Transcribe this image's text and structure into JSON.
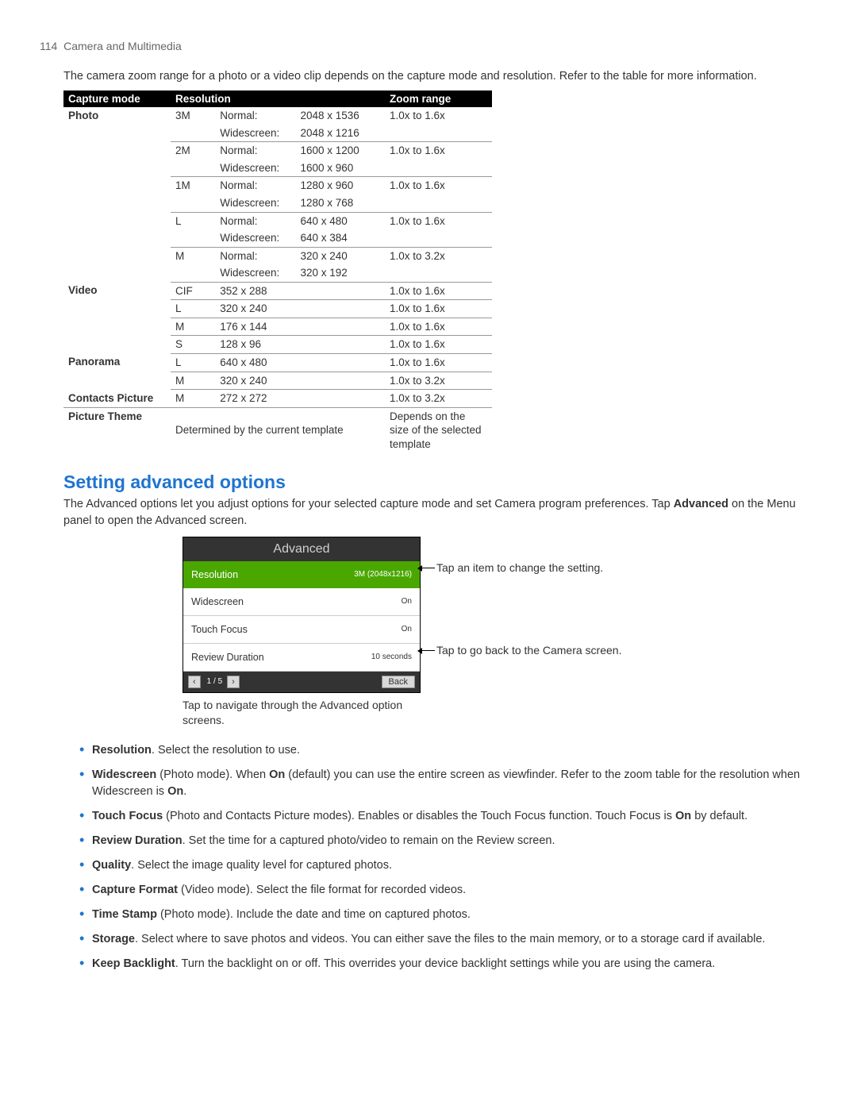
{
  "header": {
    "page_number": "114",
    "title": "Camera and Multimedia"
  },
  "intro": "The camera zoom range for a photo or a video clip depends on the capture mode and resolution. Refer to the table for more information.",
  "table": {
    "headers": {
      "mode": "Capture mode",
      "resolution": "Resolution",
      "zoom": "Zoom range"
    },
    "photo": {
      "label": "Photo",
      "rows": [
        {
          "res": "3M",
          "normal_lbl": "Normal:",
          "normal_val": "2048 x 1536",
          "wide_lbl": "Widescreen:",
          "wide_val": "2048 x 1216",
          "zoom": "1.0x to 1.6x"
        },
        {
          "res": "2M",
          "normal_lbl": "Normal:",
          "normal_val": "1600 x 1200",
          "wide_lbl": "Widescreen:",
          "wide_val": "1600 x 960",
          "zoom": "1.0x to 1.6x"
        },
        {
          "res": "1M",
          "normal_lbl": "Normal:",
          "normal_val": "1280 x 960",
          "wide_lbl": "Widescreen:",
          "wide_val": "1280 x 768",
          "zoom": "1.0x to 1.6x"
        },
        {
          "res": "L",
          "normal_lbl": "Normal:",
          "normal_val": "640 x 480",
          "wide_lbl": "Widescreen:",
          "wide_val": "640 x 384",
          "zoom": "1.0x to 1.6x"
        },
        {
          "res": "M",
          "normal_lbl": "Normal:",
          "normal_val": "320 x 240",
          "wide_lbl": "Widescreen:",
          "wide_val": "320 x 192",
          "zoom": "1.0x to 3.2x"
        }
      ]
    },
    "video": {
      "label": "Video",
      "rows": [
        {
          "res": "CIF",
          "val": "352 x 288",
          "zoom": "1.0x to 1.6x"
        },
        {
          "res": "L",
          "val": "320 x 240",
          "zoom": "1.0x to 1.6x"
        },
        {
          "res": "M",
          "val": "176 x 144",
          "zoom": "1.0x to 1.6x"
        },
        {
          "res": "S",
          "val": "128 x 96",
          "zoom": "1.0x to 1.6x"
        }
      ]
    },
    "panorama": {
      "label": "Panorama",
      "rows": [
        {
          "res": "L",
          "val": "640 x 480",
          "zoom": "1.0x to 1.6x"
        },
        {
          "res": "M",
          "val": "320 x 240",
          "zoom": "1.0x to 3.2x"
        }
      ]
    },
    "contacts": {
      "label": "Contacts Picture",
      "res": "M",
      "val": "272 x 272",
      "zoom": "1.0x to 3.2x"
    },
    "theme": {
      "label": "Picture Theme",
      "val": "Determined by the current template",
      "zoom": "Depends on the size of the selected template"
    }
  },
  "section_heading": "Setting advanced options",
  "section_text_1": "The Advanced options let you adjust options for your selected capture mode and set Camera program preferences. Tap ",
  "section_text_bold": "Advanced",
  "section_text_2": " on the Menu panel to open the Advanced screen.",
  "phone": {
    "title": "Advanced",
    "rows": [
      {
        "label": "Resolution",
        "value": "3M (2048x1216)"
      },
      {
        "label": "Widescreen",
        "value": "On"
      },
      {
        "label": "Touch Focus",
        "value": "On"
      },
      {
        "label": "Review Duration",
        "value": "10 seconds"
      }
    ],
    "prev": "‹",
    "next": "›",
    "pager": "1 / 5",
    "back": "Back"
  },
  "callouts": {
    "right1": "Tap an item to change the setting.",
    "right2": "Tap to go back to the Camera screen.",
    "below": "Tap to navigate through the Advanced option screens."
  },
  "options": [
    {
      "bold": "Resolution",
      "text": ". Select the resolution to use."
    },
    {
      "bold": "Widescreen",
      "text": " (Photo mode). When ",
      "bold2": "On",
      "text2": " (default) you can use the entire screen as viewfinder. Refer to the zoom table for the resolution when Widescreen is ",
      "bold3": "On",
      "text3": "."
    },
    {
      "bold": "Touch Focus",
      "text": " (Photo and Contacts Picture modes). Enables or disables the Touch Focus function. Touch Focus is ",
      "bold2": "On",
      "text2": " by default."
    },
    {
      "bold": "Review Duration",
      "text": ". Set the time for a captured photo/video to remain on the Review screen."
    },
    {
      "bold": "Quality",
      "text": ". Select the image quality level for captured photos."
    },
    {
      "bold": "Capture Format",
      "text": " (Video mode). Select the file format for recorded videos."
    },
    {
      "bold": "Time Stamp",
      "text": " (Photo mode). Include the date and time on captured photos."
    },
    {
      "bold": "Storage",
      "text": ". Select where to save photos and videos. You can either save the files to the main memory, or to a storage card if available."
    },
    {
      "bold": "Keep Backlight",
      "text": ". Turn the backlight on or off. This overrides your device backlight settings while you are using the camera."
    }
  ]
}
